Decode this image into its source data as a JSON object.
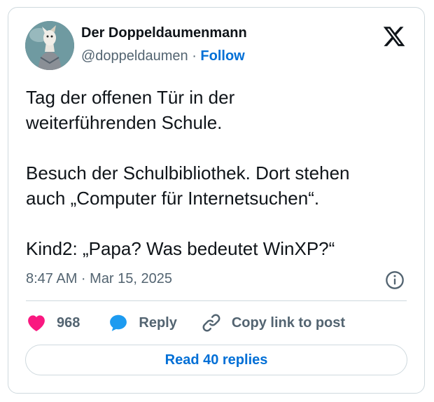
{
  "author": {
    "display_name": "Der Doppeldaumenmann",
    "handle": "@doppeldaumen",
    "separator": " · ",
    "follow_label": "Follow"
  },
  "tweet": {
    "text": "Tag der offenen Tür in der\nweiterführenden Schule.\n\nBesuch der Schulbibliothek. Dort stehen\nauch „Computer für Internetsuchen“.\n\nKind2: „Papa? Was bedeutet WinXP?“",
    "timestamp": "8:47 AM · Mar 15, 2025"
  },
  "actions": {
    "like_count": "968",
    "reply_label": "Reply",
    "copy_label": "Copy link to post"
  },
  "footer": {
    "read_replies_label": "Read 40 replies"
  },
  "colors": {
    "accent": "#006fd6",
    "like": "#f91880",
    "reply": "#1d9bf0",
    "muted": "#536471",
    "border": "#cfd9de"
  },
  "icons": {
    "logo": "x-logo-icon",
    "info": "info-icon",
    "like": "heart-icon",
    "reply": "speech-bubble-icon",
    "copy": "link-icon"
  }
}
